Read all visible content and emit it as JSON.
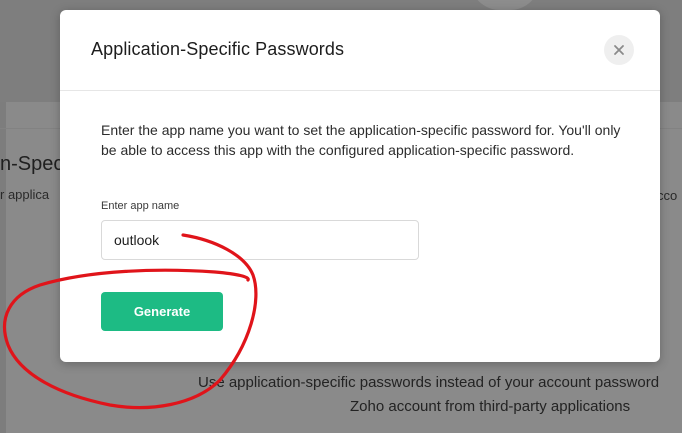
{
  "background": {
    "heading_fragment": "n-Spec",
    "subtext_fragment": "r applica",
    "right_fragment": "cco",
    "info_line_1": "Use application-specific passwords instead of your account password",
    "info_line_2": "Zoho account from third-party applications"
  },
  "modal": {
    "title": "Application-Specific Passwords",
    "close_icon": "close-icon",
    "description": "Enter the app name you want to set the application-specific password for. You'll only be able to access this app with the configured application-specific password.",
    "field_label": "Enter app name",
    "app_name_value": "outlook",
    "generate_label": "Generate"
  },
  "colors": {
    "accent": "#1dbb84",
    "annotation": "#e0141a",
    "overlay": "#7d7d7d"
  }
}
